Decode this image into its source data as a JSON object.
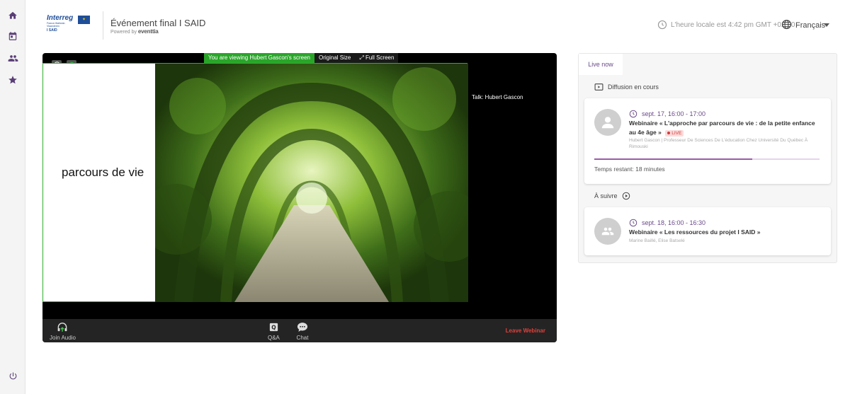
{
  "app": {
    "logo_title": "Interreg",
    "logo_sub": "France-Wallonie-Vlaanderen",
    "logo_isaid": "I SAID",
    "event_title": "Événement final I SAID",
    "powered_prefix": "Powered by",
    "powered_brand": "eventtia",
    "local_time": "L'heure locale est 4:42 pm GMT +02:00",
    "language": "Français"
  },
  "rail": {
    "icons": [
      "home-icon",
      "calendar-icon",
      "people-icon",
      "star-icon",
      "power-icon"
    ]
  },
  "player": {
    "banner_viewing": "You are viewing Hubert Gascon's screen",
    "banner_original": "Original Size",
    "banner_fullscreen": "Full Screen",
    "slide_text": "parcours de vie",
    "talk_label": "Talk:  Hubert Gascon",
    "join_audio": "Join Audio",
    "qa": "Q&A",
    "chat": "Chat",
    "leave": "Leave Webinar"
  },
  "panel": {
    "tab_live": "Live now",
    "section_now": "Diffusion en cours",
    "section_next": "À suivre",
    "current": {
      "date": "sept. 17, 16:00 - 17:00",
      "title": "Webinaire « L'approche par parcours de vie : de la petite enfance au 4e âge »",
      "live_badge": "LIVE",
      "speaker": "Hubert Gascon | Professeur De Sciences De L'éducation Chez Université Du Québec À Rimouski",
      "remaining": "Temps restant: 18 minutes",
      "progress_fraction": 0.7
    },
    "next": {
      "date": "sept. 18, 16:00 - 16:30",
      "title": "Webinaire « Les ressources du projet I SAID »",
      "speaker": "Marine Baillé, Elise Batselé"
    }
  },
  "colors": {
    "accent": "#6b4a8a",
    "live_red": "#d23b3b",
    "leave_red": "#e0413a",
    "banner_green": "#2aa52a",
    "rail_icon": "#5a3d78"
  }
}
